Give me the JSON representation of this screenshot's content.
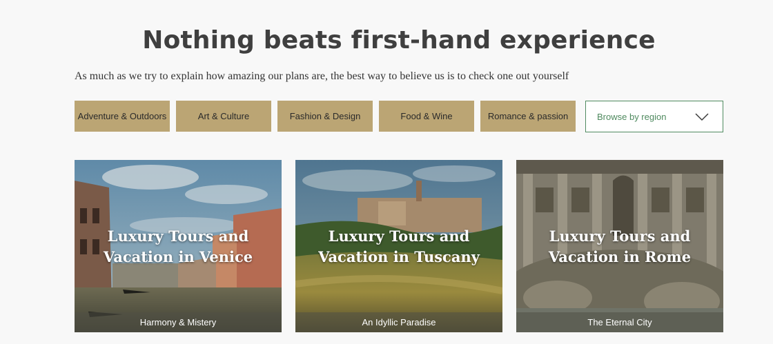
{
  "header": {
    "title": "Nothing beats first-hand experience",
    "subtitle": "As much as we try to explain how amazing our plans are, the best way to believe us is to check one out yourself"
  },
  "filters": [
    {
      "label": "Adventure & Outdoors"
    },
    {
      "label": "Art & Culture"
    },
    {
      "label": "Fashion & Design"
    },
    {
      "label": "Food & Wine"
    },
    {
      "label": "Romance & passion"
    }
  ],
  "region_select": {
    "label": "Browse by region",
    "icon": "chevron-down-icon"
  },
  "tours": [
    {
      "title_line1": "Luxury Tours and",
      "title_line2": "Vacation in Venice",
      "caption": "Harmony & Mistery"
    },
    {
      "title_line1": "Luxury Tours and",
      "title_line2": "Vacation in Tuscany",
      "caption": "An Idyllic Paradise"
    },
    {
      "title_line1": "Luxury Tours and",
      "title_line2": "Vacation in Rome",
      "caption": "The Eternal City"
    }
  ],
  "colors": {
    "filter_bg": "#bba574",
    "region_accent": "#4f8a5f",
    "heading": "#3f3f3f"
  }
}
